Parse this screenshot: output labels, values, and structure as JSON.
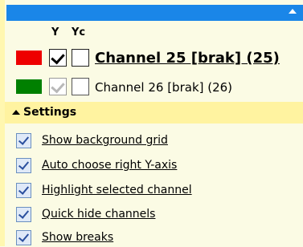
{
  "columns": {
    "y": "Y",
    "yc": "Yc"
  },
  "channels": [
    {
      "label": "Channel 25 [brak] (25)",
      "color": "#ee0000",
      "y_checked": true,
      "yc_checked": false,
      "bold": true
    },
    {
      "label": "Channel 26 [brak] (26)",
      "color": "#008000",
      "y_checked": true,
      "yc_checked": false,
      "bold": false
    }
  ],
  "settings": {
    "header": "Settings",
    "items": [
      {
        "label": "Show background grid",
        "checked": true
      },
      {
        "label": "Auto choose right Y-axis",
        "checked": true
      },
      {
        "label": "Highlight selected channel",
        "checked": true
      },
      {
        "label": "Quick hide channels",
        "checked": true
      },
      {
        "label": "Show breaks",
        "checked": true
      }
    ]
  },
  "colors": {
    "titlebar": "#1a86e8",
    "settings_header": "#fff3a0",
    "panel_bg": "#fbfbe4"
  },
  "icons": {
    "collapse": "chevron-up-icon",
    "settings_toggle": "triangle-up-icon"
  }
}
